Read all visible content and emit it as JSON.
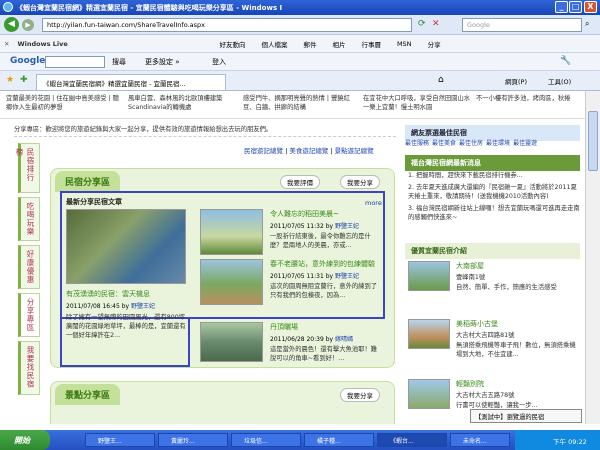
{
  "window": {
    "title": "《蝦台灣宜蘭民宿網》精選宜蘭民宿 - 宜蘭民宿體驗與吃喝玩樂分享區 - Windows I",
    "url": "http://yilan.fun-taiwan.com/ShareTravelInfo.aspx",
    "search_placeholder": "Google",
    "min": "_",
    "max": "□",
    "close": "X"
  },
  "toolbar": {
    "windows_live": "Windows Live",
    "items": [
      "好友動向",
      "個人檔案",
      "郵件",
      "相片",
      "行事曆",
      "MSN",
      "分享"
    ],
    "google_label": "Google",
    "search_btn": "搜尋",
    "more": "更多設定 »",
    "signin": "登入"
  },
  "tabs": {
    "active": "《蝦台灣宜蘭民宿網》精選宜蘭民宿 - 宜蘭民宿...",
    "home_icons": [
      "網頁(P)",
      "工具(O)"
    ]
  },
  "page": {
    "top_snippets": [
      "宜蘭最美的花園 | 住在幽中島美感受 | 聽鄉你入生最初的夢想",
      "風車白雲、森林風的北歐頂樓建築Scandinavia的轉機處",
      "感受門牛、摘那明亮聲的熱情 | 豐饒紅豆、白牆、拱廊的結構",
      "在宜花中大口呼吸，享受自然田園山水一樂上宜蘭！慢土明水園",
      "不一小樓有許多池，烤肉區，秋捲"
    ],
    "share_bar": "分享專區：歡迎將您的旅遊紀錄與大家一起分享，提供有效的旅遊情報給想出去玩的朋友們。",
    "share_links": [
      "民宿遊記總覽",
      "美食遊記總覽",
      "景點遊記總覽"
    ],
    "vtabs": [
      "民宿排行榜",
      "吃喝玩樂",
      "好康優惠",
      "分享專區",
      "我要找民宿"
    ],
    "minsu_panel": {
      "title": "民宿分享區",
      "btn_review": "我要評價",
      "btn_share": "我要分享",
      "latest": "最新分享民宿文章",
      "more": "more",
      "main_article": {
        "title": "有茂湧湧的民宿：雲天機息",
        "date": "2011/07/08 16:45",
        "author_prefix": "by",
        "author": "野鹽王妃",
        "body": "除了擁有一望無際的田園風光，還有800坪廣闊的花園綠地草坪，最棒的是，宜蘭還有一個好年緯許在2..."
      },
      "articles": [
        {
          "title": "令人難忘的稻田美晨~",
          "date": "2011/07/05 11:32",
          "author": "野鹽王妃",
          "body": "一股祈行結東後，最令你難忘的是什麼？是兩地人的美晨，亦或..."
        },
        {
          "title": "春不老腰站，意外練到的包練體驗",
          "date": "2011/07/05 11:31",
          "author": "野鹽王妃",
          "body": "這次的園周無阻宜蘭行，意外的練到了只有我們的包棟夜，因為..."
        },
        {
          "title": "丹頂曬場",
          "date": "2011/06/28 20:39",
          "author": "嫁晴嫣",
          "body": "這是當外的晨色！還有擊大魚池耶！難說可以的角車~看到好！..."
        }
      ]
    },
    "scenic_panel": {
      "title": "景點分享區",
      "btn_share": "我要分享"
    },
    "right": {
      "hotlist_title": "網友票選最佳民宿",
      "hotlist_tabs": [
        "最佳服務",
        "最佳美食",
        "最佳住房",
        "最佳環境",
        "最佳靈遊"
      ],
      "news_title": "福台灣民宿網最新消息",
      "news": [
        "1.  把握時間，趕快來下載民宿排行機券...",
        "2.  去年夏天進成廣大還編的『民宿雜一夏』活動將於2011夏天捲土重來，敬請期待！(送我機機2010活動內容)",
        "3.  福台灣民宿網新往站上線囉！想去宜蘭玩嗎還可進再走走南的感觸們快進來~"
      ],
      "recommend_title": "優質宜蘭民宿介紹",
      "recs": [
        {
          "name": "大南部屋",
          "line1": "壹峰南1號",
          "line2": "自然、簡單、手作，簡應的生活感受"
        },
        {
          "name": "美稻蒔小古堡",
          "line1": "大吉村大吉四路81號",
          "line2": "無須搭乘飛機等車子飛！數位，無須搭乘機場到大地，不住宜建..."
        },
        {
          "name": "輕豔別院",
          "line1": "大吉村大吉五路78號",
          "line2": "行書可以使輕豔，讓我一步..."
        }
      ]
    },
    "popup": "【測試中】瀏覽過的民宿"
  },
  "taskbar": {
    "start": "開始",
    "items": [
      "野鹽王...",
      "黃麗玲...",
      "垃圾信...",
      "橘子種...",
      "《蝦台...",
      "未命名..."
    ],
    "time": "下午 09:22"
  }
}
